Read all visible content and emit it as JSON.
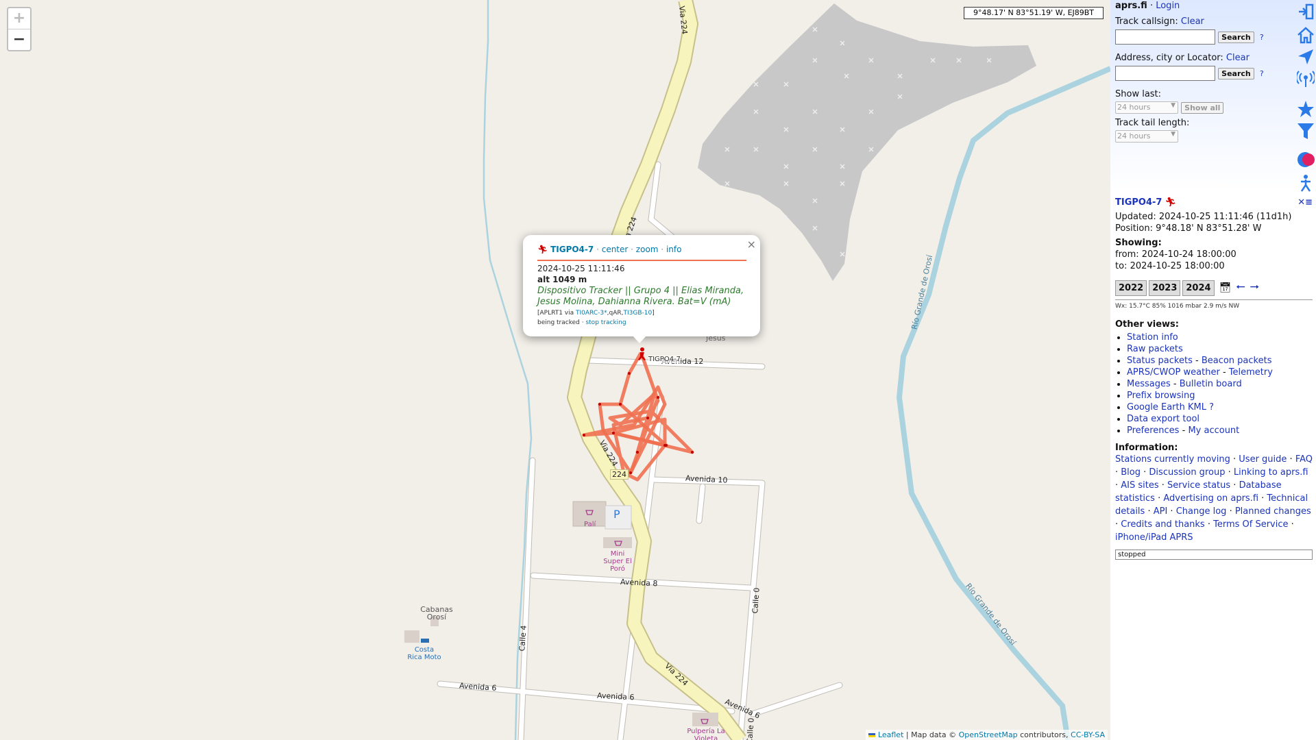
{
  "map": {
    "zoom_in": "+",
    "zoom_out": "−",
    "coord_readout": "9°48.17' N 83°51.19' W, EJ89BT",
    "attribution": {
      "leaflet": "Leaflet",
      "sep1": "|",
      "mapdata": "Map data ©",
      "osm": "OpenStreetMap",
      "contrib": "contributors,",
      "license": "CC-BY-SA"
    },
    "streets": [
      "Via 224",
      "Via 224",
      "Via 224",
      "Avenida 10",
      "Avenida 8",
      "Avenida 6",
      "Avenida 6",
      "Avenida 6",
      "Calle 4",
      "Calle 0",
      "Calle 0",
      "224",
      "Avenida 12",
      "Río Grande de Orosí",
      "Río Grande de Orosí"
    ],
    "places": [
      "Jesus",
      "Palí",
      "Mini Super El Poró",
      "Cabanas Orosí",
      "Costa Rica Moto",
      "Pulpería La Violeta",
      "P"
    ],
    "station_label": "TIGPO4-7",
    "track_color": "#f07050"
  },
  "popup": {
    "callsign": "TIGPO4-7",
    "links": [
      "center",
      "zoom",
      "info"
    ],
    "timestamp": "2024-10-25 11:11:46",
    "alt": "alt 1049 m",
    "comment": "Dispositivo Tracker || Grupo 4 || Elias Miranda, Jesus Molina, Dahianna Rivera. Bat=V (mA)",
    "path_prefix": "[APLRT1 via",
    "path_link1": "TI0ARC-3*",
    "path_mid": ",qAR,",
    "path_link2": "TI3GB-10",
    "path_suffix": "]",
    "tracking": "being tracked",
    "stop_tracking": "stop tracking",
    "close": "×"
  },
  "sidebar": {
    "brand": "aprs.fi",
    "login": "Login",
    "track_callsign_label": "Track callsign:",
    "clear": "Clear",
    "search": "Search",
    "help": "?",
    "address_label": "Address, city or Locator:",
    "show_last_label": "Show last:",
    "show_last_value": "24 hours",
    "show_all": "Show all",
    "tail_label": "Track tail length:",
    "tail_value": "24 hours",
    "icons": [
      "login-icon",
      "home-icon",
      "send-icon",
      "antenna-icon",
      "star-icon",
      "filter-icon",
      "color-icon",
      "person-icon"
    ],
    "colors": {
      "accent": "#1a33bb",
      "icon": "#2a7ae8"
    }
  },
  "station": {
    "name": "TIGPO4-7",
    "updated": "Updated: 2024-10-25 11:11:46 (11d1h)",
    "position": "Position: 9°48.18' N 83°51.28' W",
    "showing": "Showing:",
    "from": "from: 2024-10-24 18:00:00",
    "to": "to: 2024-10-25 18:00:00",
    "years": [
      "2022",
      "2023",
      "2024"
    ],
    "wx": "Wx: 15.7°C 85% 1016 mbar 2.9 m/s NW",
    "other_views_title": "Other views:",
    "views": [
      [
        "Station info"
      ],
      [
        "Raw packets"
      ],
      [
        "Status packets",
        "Beacon packets"
      ],
      [
        "APRS/CWOP weather",
        "Telemetry"
      ],
      [
        "Messages",
        "Bulletin board"
      ],
      [
        "Prefix browsing"
      ],
      [
        "Google Earth KML ?"
      ],
      [
        "Data export tool"
      ],
      [
        "Preferences",
        "My account"
      ]
    ],
    "information_title": "Information:",
    "info_links": [
      "Stations currently moving",
      "User guide",
      "FAQ",
      "Blog",
      "Discussion group",
      "Linking to aprs.fi",
      "AIS sites",
      "Service status",
      "Database statistics",
      "Advertising on aprs.fi",
      "Technical details",
      "API",
      "Change log",
      "Planned changes",
      "Credits and thanks",
      "Terms Of Service",
      "iPhone/iPad APRS"
    ],
    "status": "stopped"
  }
}
